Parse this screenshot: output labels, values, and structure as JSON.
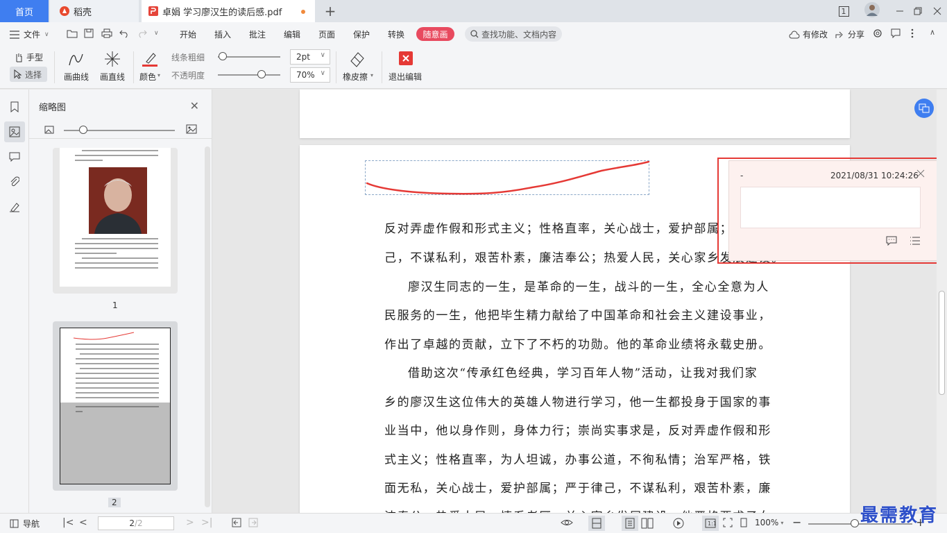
{
  "tabs": {
    "home": "首页",
    "docer": "稻壳",
    "doc": "卓娟 学习廖汉生的读后感.pdf",
    "add": "+"
  },
  "window": {
    "badge": "1"
  },
  "menu": {
    "file": "文件",
    "items": [
      "开始",
      "插入",
      "批注",
      "编辑",
      "页面",
      "保护",
      "转换"
    ],
    "mode_badge": "随意画",
    "search_placeholder": "查找功能、文档内容",
    "modified": "有修改",
    "share": "分享"
  },
  "toolbar": {
    "hand": "手型",
    "select": "选择",
    "curve": "画曲线",
    "straight": "画直线",
    "color": "颜色",
    "line_width_label": "线条粗细",
    "line_width_value": "2pt",
    "opacity_label": "不透明度",
    "opacity_value": "70%",
    "opacity_fraction": 0.7,
    "eraser": "橡皮擦",
    "exit": "退出编辑",
    "pen_color": "#e53935"
  },
  "thumbnails": {
    "title": "缩略图",
    "page1_label": "1",
    "page2_label": "2"
  },
  "document": {
    "lines": [
      "反对弄虚作假和形式主义；性格直率，关心战士，爱护部属；",
      "己，不谋私利，艰苦朴素，廉洁奉公；热爱人民，关心家乡发展建设。",
      "廖汉生同志的一生，是革命的一生，战斗的一生，全心全意为人",
      "民服务的一生，他把毕生精力献给了中国革命和社会主义建设事业，",
      "作出了卓越的贡献，立下了不朽的功勋。他的革命业绩将永载史册。",
      "借助这次“传承红色经典，学习百年人物”活动，让我对我们家",
      "乡的廖汉生这位伟大的英雄人物进行学习，他一生都投身于国家的事",
      "业当中，他以身作则，身体力行；崇尚实事求是，反对弄虚作假和形",
      "式主义；性格直率，为人坦诚，办事公道，不徇私情；治军严格，铁",
      "面无私，关心战士，爱护部属；严于律己，不谋私利，艰苦朴素，廉",
      "洁奉公，热爱人民，情系老区，关心家乡发展建设，他严格要求子女"
    ]
  },
  "comment": {
    "author": "-",
    "timestamp": "2021/08/31 10:24:26"
  },
  "status": {
    "nav": "导航",
    "page_current": "2",
    "page_total": "/2",
    "zoom": "100%"
  },
  "watermark": "最需教育"
}
